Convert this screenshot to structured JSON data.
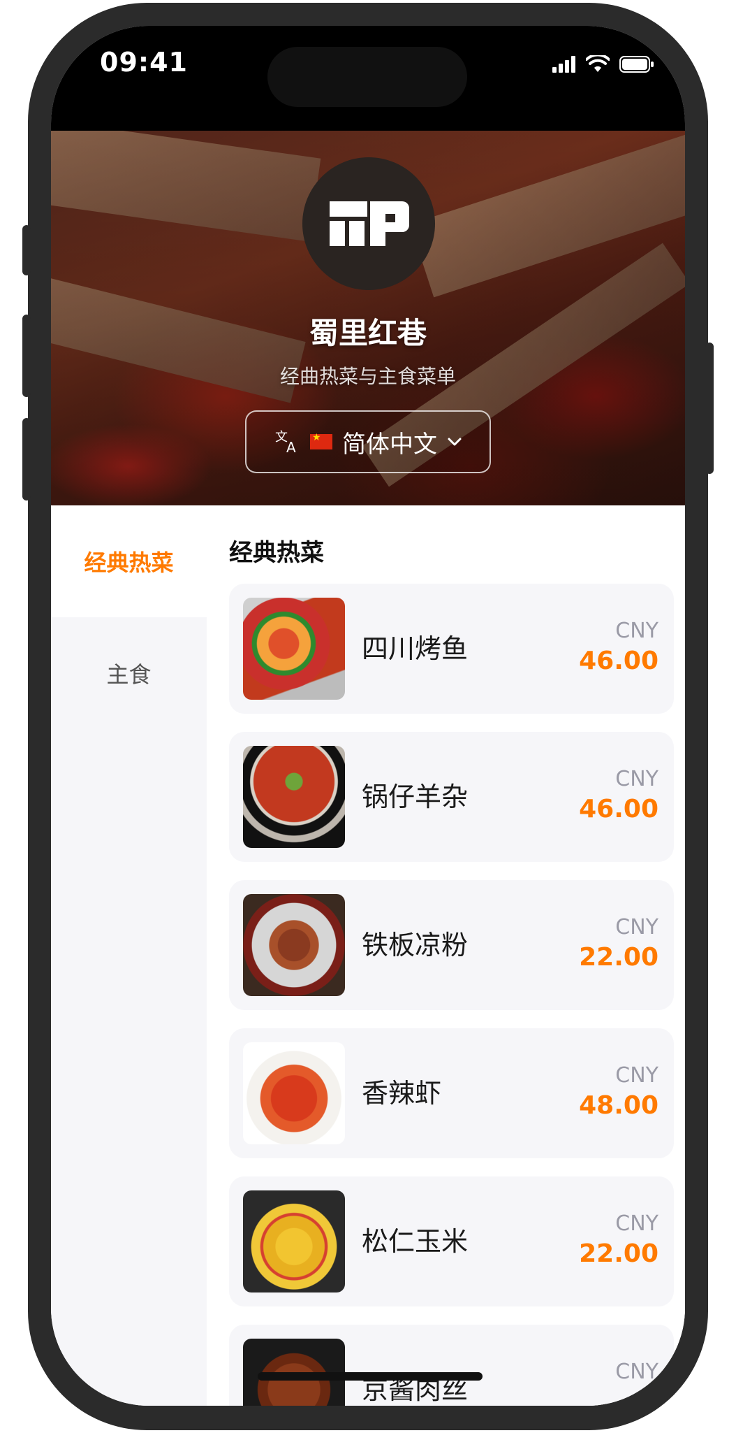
{
  "status_bar": {
    "time": "09:41"
  },
  "restaurant": {
    "name": "蜀里红巷",
    "subtitle": "经曲热菜与主食菜单"
  },
  "language_selector": {
    "label": "简体中文",
    "flag": "cn-flag-icon"
  },
  "sidebar": {
    "items": [
      {
        "label": "经典热菜",
        "active": true
      },
      {
        "label": "主食",
        "active": false
      }
    ]
  },
  "section": {
    "title": "经典热菜"
  },
  "dishes": [
    {
      "name": "四川烤鱼",
      "currency": "CNY",
      "price": "46.00"
    },
    {
      "name": "锅仔羊杂",
      "currency": "CNY",
      "price": "46.00"
    },
    {
      "name": "铁板凉粉",
      "currency": "CNY",
      "price": "22.00"
    },
    {
      "name": "香辣虾",
      "currency": "CNY",
      "price": "48.00"
    },
    {
      "name": "松仁玉米",
      "currency": "CNY",
      "price": "22.00"
    },
    {
      "name": "京酱肉丝",
      "currency": "CNY",
      "price": ""
    }
  ],
  "colors": {
    "accent": "#ff7a00",
    "card_bg": "#f6f6f9",
    "muted": "#9a9aa6"
  }
}
